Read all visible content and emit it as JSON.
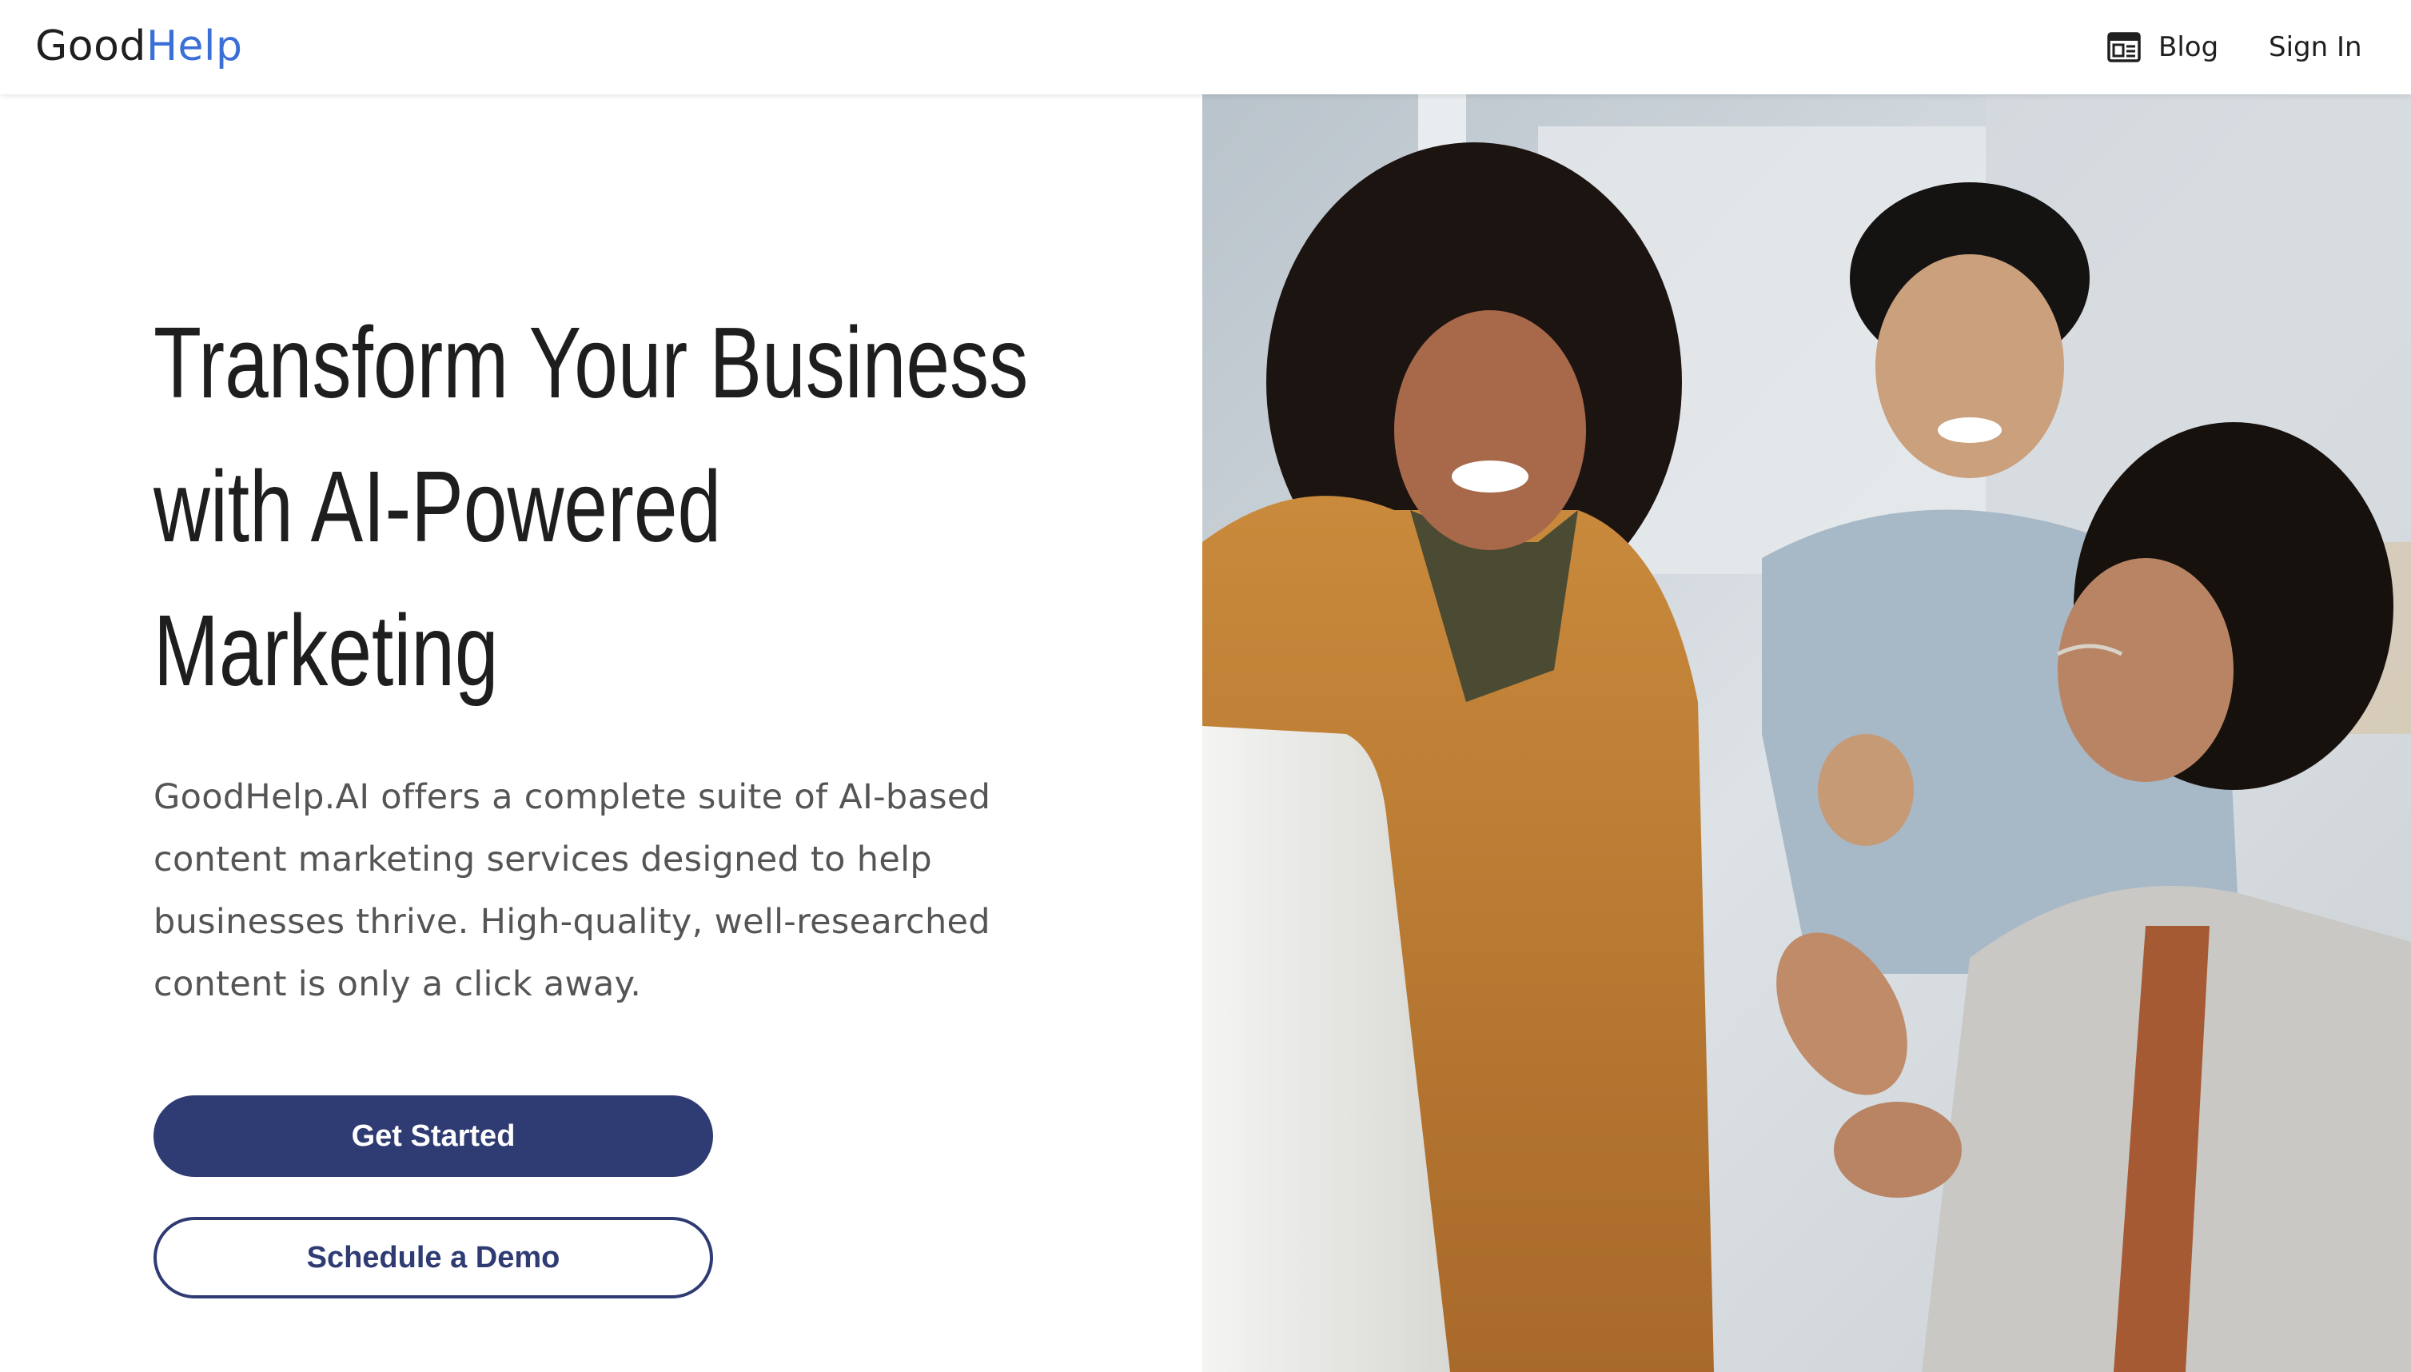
{
  "header": {
    "logo": {
      "part1": "Good",
      "part2": "Help"
    },
    "nav": {
      "blog_label": "Blog",
      "signin_label": "Sign In"
    }
  },
  "hero": {
    "headline_line1": "Transform Your Business",
    "headline_line2": "with AI-Powered",
    "headline_line3": "Marketing",
    "description": "GoodHelp.AI offers a complete suite of AI-based content marketing services designed to help businesses thrive. High-quality, well-researched content is only a click away.",
    "primary_button": "Get Started",
    "secondary_button": "Schedule a Demo",
    "image_alt": "Three colleagues smiling and celebrating while looking at a computer screen"
  },
  "colors": {
    "brand_blue": "#3a6fd8",
    "button_navy": "#2f3b73",
    "text_dark": "#1e1e1e",
    "text_muted": "#555555"
  },
  "icons": {
    "blog": "newspaper-icon"
  }
}
